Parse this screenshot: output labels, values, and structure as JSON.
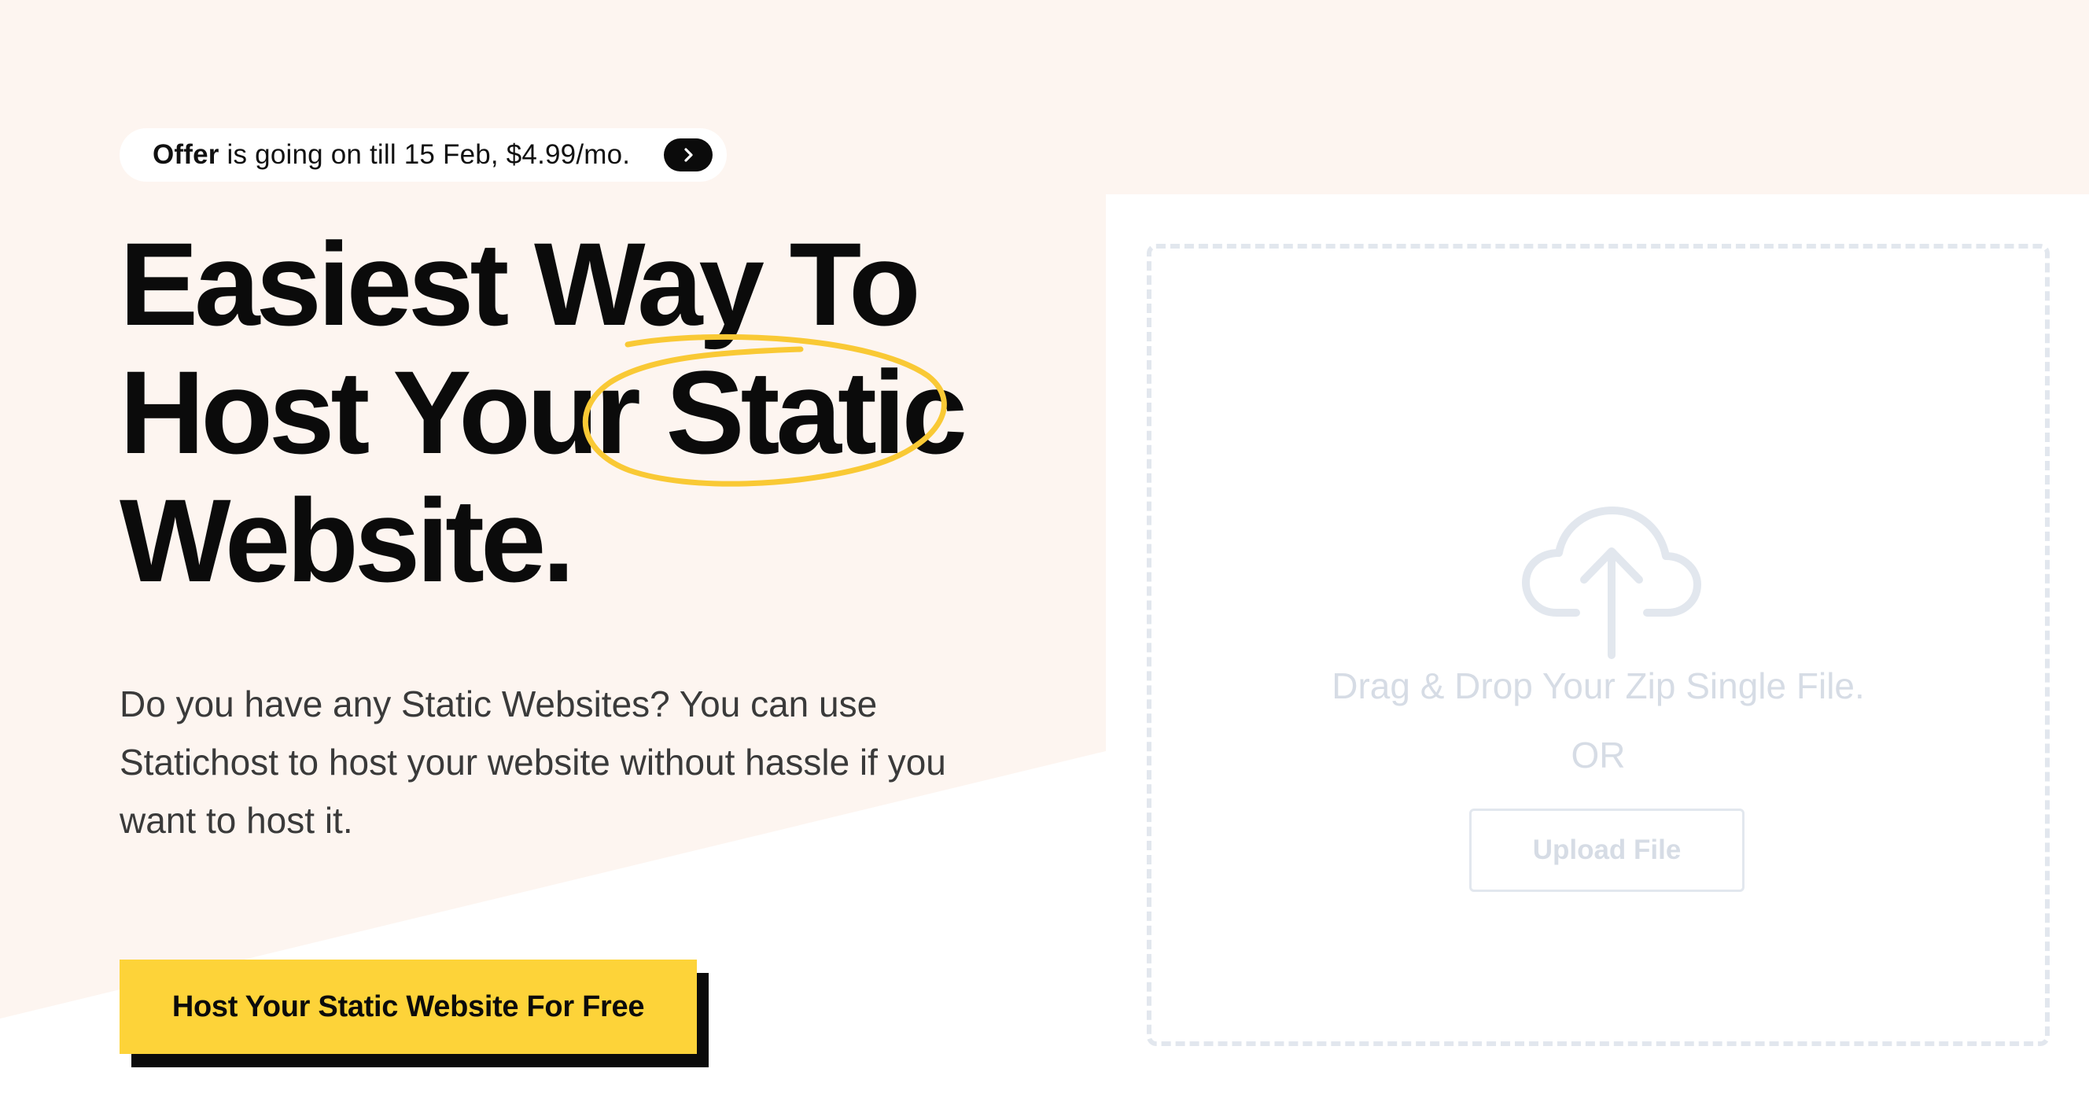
{
  "offer": {
    "strong_label": "Offer",
    "text": " is going on till 15 Feb, $4.99/mo.",
    "arrow_icon": "chevron-right-icon"
  },
  "hero": {
    "line1": "Easiest Way To",
    "line2_prefix": "Host Your ",
    "line2_highlight": "Static",
    "line3": "Website.",
    "description": "Do you have any Static Websites? You can use Statichost to host your website without hassle if you want to host it."
  },
  "cta": {
    "label": "Host Your Static Website For Free"
  },
  "upload": {
    "icon": "cloud-upload-icon",
    "drop_text": "Drag & Drop Your Zip Single File.",
    "or_text": "OR",
    "button_label": "Upload File"
  },
  "colors": {
    "background_tint": "#fdf5f0",
    "accent_yellow": "#fdd339",
    "circle_stroke": "#f9c935",
    "text_dark": "#0b0b0b",
    "muted": "#d6dce5"
  }
}
